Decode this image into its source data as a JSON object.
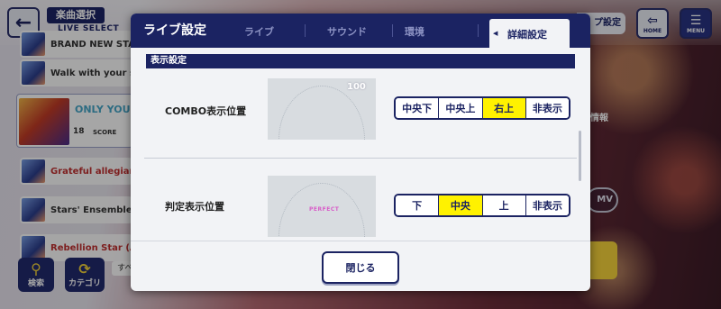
{
  "background": {
    "header_label": "楽曲選択",
    "header_sub": "LIVE SELECT",
    "songs": [
      {
        "name": "BRAND NEW STA"
      },
      {
        "name": "Walk with your su"
      },
      {
        "name": "Grateful allegian"
      },
      {
        "name": "Stars' Ensemble!"
      },
      {
        "name": "Rebellion Star (A"
      }
    ],
    "selected_song": {
      "name": "ONLY YOU",
      "level": "18",
      "score_label": "SCORE"
    },
    "search_label": "検索",
    "category_label": "カテゴリ",
    "sub_chip": "すべ",
    "live_setting_label": "プ設定",
    "home_label": "HOME",
    "menu_label": "MENU",
    "info_label": "情報",
    "mv_label": "MV"
  },
  "modal": {
    "title": "ライブ設定",
    "tabs": [
      {
        "label": "ライブ"
      },
      {
        "label": "サウンド"
      },
      {
        "label": "環境"
      },
      {
        "label": "詳細設定"
      }
    ],
    "active_tab": "詳細設定",
    "section_title": "表示設定",
    "settings": [
      {
        "label": "COMBO表示位置",
        "preview_text": "100",
        "options": [
          "中央下",
          "中央上",
          "右上",
          "非表示"
        ],
        "selected": "右上"
      },
      {
        "label": "判定表示位置",
        "preview_text": "PERFECT",
        "options": [
          "下",
          "中央",
          "上",
          "非表示"
        ],
        "selected": "中央"
      }
    ],
    "close_label": "閉じる"
  },
  "colors": {
    "navy": "#1b2362",
    "selected": "#fff200",
    "panel": "#f2f3f6"
  }
}
